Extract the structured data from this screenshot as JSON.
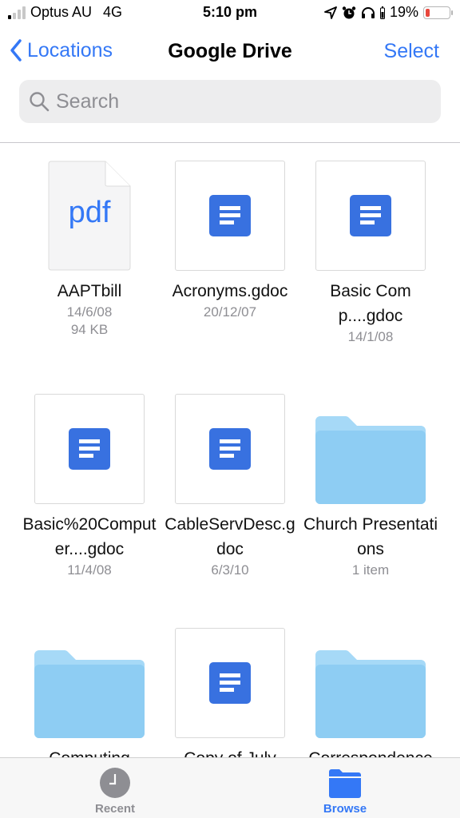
{
  "status_bar": {
    "carrier": "Optus AU",
    "network": "4G",
    "time": "5:10 pm",
    "battery_percent_label": "19%",
    "battery_level": 0.19,
    "signal_bars_active": 1,
    "signal_bars_total": 4,
    "icons": [
      "location-arrow-icon",
      "alarm-icon",
      "headphones-icon",
      "headphone-battery-icon",
      "battery-icon"
    ]
  },
  "nav": {
    "back_label": "Locations",
    "title": "Google Drive",
    "select_label": "Select"
  },
  "search": {
    "placeholder": "Search",
    "value": ""
  },
  "colors": {
    "accent": "#3478f6",
    "gdoc_blue": "#3871e0",
    "folder_blue": "#8ecdf3",
    "battery_low": "#e8463c"
  },
  "items": [
    {
      "type": "pdf",
      "icon_text": "pdf",
      "name": "AAPTbill",
      "date": "14/6/08",
      "size": "94 KB"
    },
    {
      "type": "gdoc",
      "name": "Acronyms.gdoc",
      "date": "20/12/07"
    },
    {
      "type": "gdoc",
      "name": "Basic Comp....gdoc",
      "date": "14/1/08"
    },
    {
      "type": "gdoc",
      "name": "Basic%20Computer....gdoc",
      "date": "11/4/08"
    },
    {
      "type": "gdoc",
      "name": "CableServDesc.gdoc",
      "date": "6/3/10"
    },
    {
      "type": "folder",
      "name": "Church Presentations",
      "count": "1 item"
    },
    {
      "type": "folder",
      "name": "Computing"
    },
    {
      "type": "gdoc",
      "name": "Copy of July"
    },
    {
      "type": "folder",
      "name": "Correspondence"
    }
  ],
  "tabbar": {
    "tabs": [
      {
        "label": "Recent",
        "icon": "clock-icon",
        "active": false
      },
      {
        "label": "Browse",
        "icon": "folder-icon",
        "active": true
      }
    ]
  }
}
